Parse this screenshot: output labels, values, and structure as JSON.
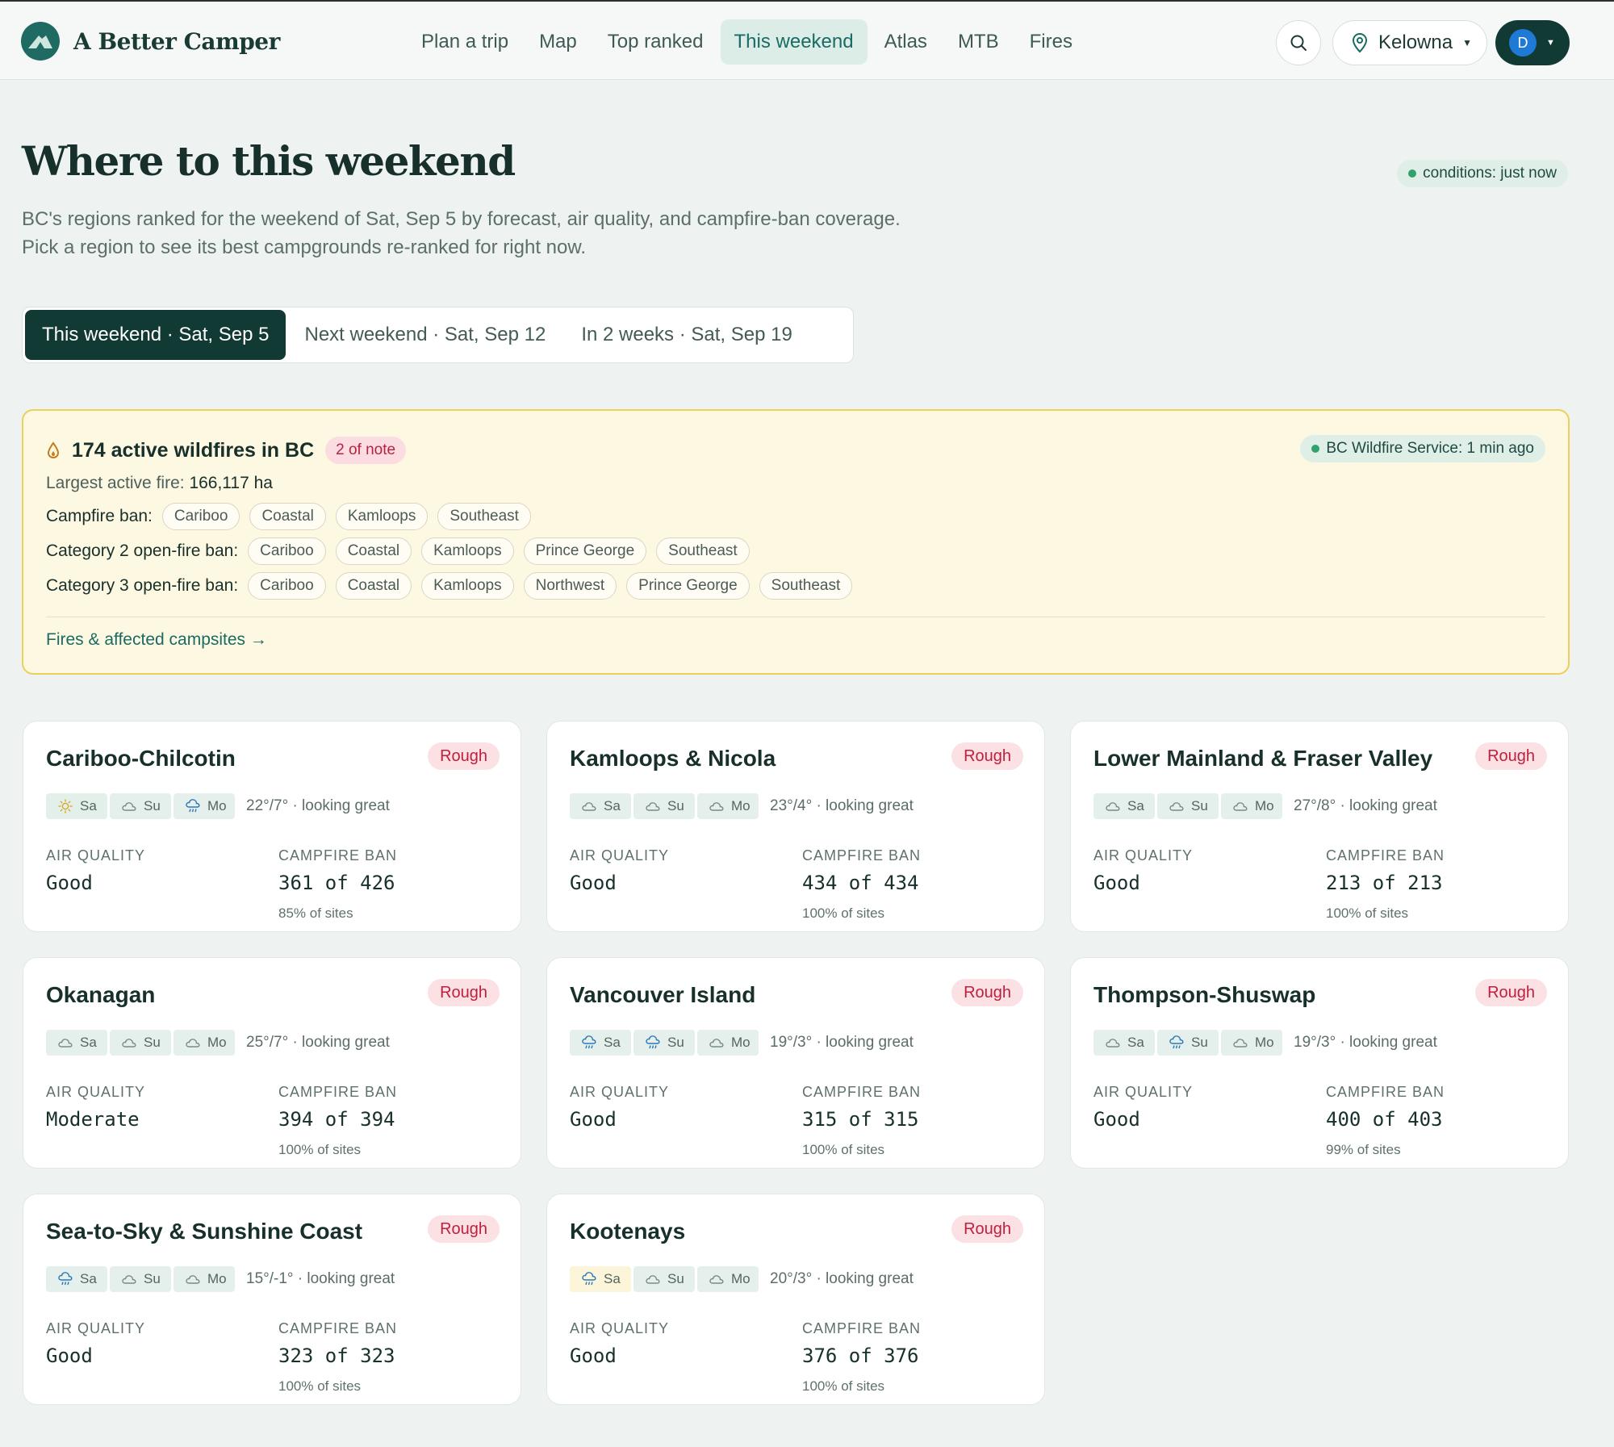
{
  "brand": {
    "name": "A Better Camper"
  },
  "nav": [
    "Plan a trip",
    "Map",
    "Top ranked",
    "This weekend",
    "Atlas",
    "MTB",
    "Fires"
  ],
  "header": {
    "location": "Kelowna",
    "user_initial": "D"
  },
  "hero": {
    "title": "Where to this weekend",
    "subtitle": "BC's regions ranked for the weekend of Sat, Sep 5 by forecast, air quality, and campfire-ban coverage. Pick a region to see its best campgrounds re-ranked for right now.",
    "conditions": "conditions: just now"
  },
  "tabs": [
    "This weekend · Sat, Sep 5",
    "Next weekend · Sat, Sep 12",
    "In 2 weeks · Sat, Sep 19"
  ],
  "fires": {
    "title": "174 active wildfires in BC",
    "note": "2 of note",
    "source": "BC Wildfire Service: 1 min ago",
    "largest_label": "Largest active fire:",
    "largest_value": "166,117 ha",
    "campfire_label": "Campfire ban:",
    "campfire": [
      "Cariboo",
      "Coastal",
      "Kamloops",
      "Southeast"
    ],
    "cat2_label": "Category 2 open-fire ban:",
    "cat2": [
      "Cariboo",
      "Coastal",
      "Kamloops",
      "Prince George",
      "Southeast"
    ],
    "cat3_label": "Category 3 open-fire ban:",
    "cat3": [
      "Cariboo",
      "Coastal",
      "Kamloops",
      "Northwest",
      "Prince George",
      "Southeast"
    ],
    "link": "Fires & affected campsites →"
  },
  "labels": {
    "air": "AIR QUALITY",
    "ban": "CAMPFIRE BAN",
    "day1": "Sa",
    "day2": "Su",
    "day3": "Mo"
  },
  "regions": [
    {
      "name": "Cariboo-Chilcotin",
      "rating": "Rough",
      "forecast": "22°/7° · looking great",
      "air": "Good",
      "ban": "361 of 426",
      "pct": "85% of sites"
    },
    {
      "name": "Kamloops & Nicola",
      "rating": "Rough",
      "forecast": "23°/4° · looking great",
      "air": "Good",
      "ban": "434 of 434",
      "pct": "100% of sites"
    },
    {
      "name": "Lower Mainland & Fraser Valley",
      "rating": "Rough",
      "forecast": "27°/8° · looking great",
      "air": "Good",
      "ban": "213 of 213",
      "pct": "100% of sites"
    },
    {
      "name": "Okanagan",
      "rating": "Rough",
      "forecast": "25°/7° · looking great",
      "air": "Moderate",
      "ban": "394 of 394",
      "pct": "100% of sites"
    },
    {
      "name": "Vancouver Island",
      "rating": "Rough",
      "forecast": "19°/3° · looking great",
      "air": "Good",
      "ban": "315 of 315",
      "pct": "100% of sites"
    },
    {
      "name": "Thompson-Shuswap",
      "rating": "Rough",
      "forecast": "19°/3° · looking great",
      "air": "Good",
      "ban": "400 of 403",
      "pct": "99% of sites"
    },
    {
      "name": "Sea-to-Sky & Sunshine Coast",
      "rating": "Rough",
      "forecast": "15°/-1° · looking great",
      "air": "Good",
      "ban": "323 of 323",
      "pct": "100% of sites"
    },
    {
      "name": "Kootenays",
      "rating": "Rough",
      "forecast": "20°/3° · looking great",
      "air": "Good",
      "ban": "376 of 376",
      "pct": "100% of sites"
    }
  ]
}
